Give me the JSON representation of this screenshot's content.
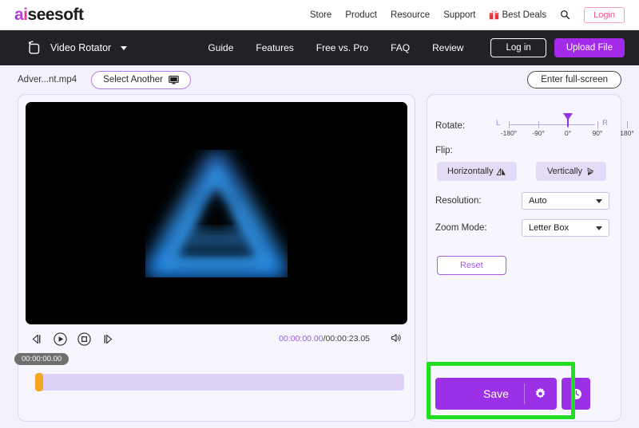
{
  "header": {
    "logo_ai": "ai",
    "logo_rest": "seesoft",
    "nav": [
      {
        "label": "Store",
        "name": "store"
      },
      {
        "label": "Product",
        "name": "product"
      },
      {
        "label": "Resource",
        "name": "resource"
      },
      {
        "label": "Support",
        "name": "support"
      }
    ],
    "best_deals_label": "Best Deals",
    "login_label": "Login",
    "icons": {
      "gift": "gift-icon",
      "search": "search-icon"
    }
  },
  "toolnav": {
    "tool_name": "Video Rotator",
    "links": [
      {
        "label": "Guide",
        "name": "guide"
      },
      {
        "label": "Features",
        "name": "features"
      },
      {
        "label": "Free vs. Pro",
        "name": "free-vs-pro"
      },
      {
        "label": "FAQ",
        "name": "faq"
      },
      {
        "label": "Review",
        "name": "review"
      }
    ],
    "login_label": "Log in",
    "upload_label": "Upload File",
    "icon": "video-rotate-icon"
  },
  "subbar": {
    "file_name": "Adver...nt.mp4",
    "select_another_label": "Select Another",
    "select_another_icon": "monitor-icon",
    "fullscreen_label": "Enter full-screen"
  },
  "player": {
    "controls": [
      {
        "name": "previous-frame-button",
        "glyph": "prev"
      },
      {
        "name": "play-button",
        "glyph": "play"
      },
      {
        "name": "stop-button",
        "glyph": "stop"
      },
      {
        "name": "next-frame-button",
        "glyph": "next"
      }
    ],
    "current_time": "00:00:00.00",
    "separator": "/",
    "total_time": "00:00:23.05",
    "volume_icon": "volume-icon",
    "timeline_tooltip": "00:00:00.00"
  },
  "settings": {
    "rotate_label": "Rotate:",
    "rotate_left_label": "L",
    "rotate_right_label": "R",
    "rotate_ticks": [
      "-180°",
      "-90°",
      "0°",
      "90°",
      "180°"
    ],
    "rotate_value": "0°",
    "flip_label": "Flip:",
    "flip_horizontal_label": "Horizontally",
    "flip_vertical_label": "Vertically",
    "resolution_label": "Resolution:",
    "resolution_value": "Auto",
    "zoom_mode_label": "Zoom Mode:",
    "zoom_mode_value": "Letter Box",
    "reset_label": "Reset"
  },
  "actions": {
    "save_label": "Save",
    "save_settings_icon": "gear-icon",
    "history_icon": "clock-icon"
  },
  "colors": {
    "accent_purple": "#9b30e6",
    "nav_dark": "#242126",
    "panel_bg": "#f7f5fd",
    "highlight_green": "#22dd22",
    "playhead_orange": "#f5a623",
    "login_pink": "#f0568e"
  }
}
